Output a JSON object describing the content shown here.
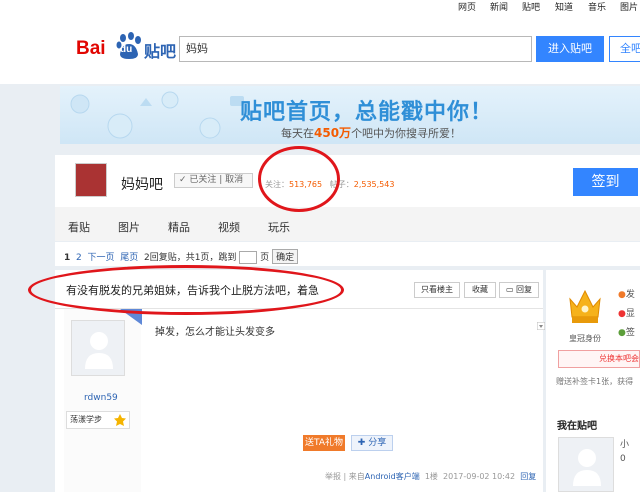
{
  "top_nav": [
    "网页",
    "新闻",
    "贴吧",
    "知道",
    "音乐",
    "图片"
  ],
  "search": {
    "value": "妈妈",
    "enter_label": "进入贴吧",
    "search_all_label": "全吧"
  },
  "logo": {
    "bai": "Bai",
    "du": "du",
    "tieba": "贴吧"
  },
  "banner": {
    "title": "贴吧首页，总能戳中你！",
    "sub_prefix": "每天在",
    "sub_highlight": "450万",
    "sub_suffix": "个吧中为你搜寻所爱！"
  },
  "forum": {
    "name": "妈妈吧",
    "follow_status": "✓ 已关注 | 取消",
    "followers_label": "关注：",
    "followers": "513,765",
    "posts_label": "帖子：",
    "posts": "2,535,543",
    "signin_label": "签到"
  },
  "tabs": [
    "看贴",
    "图片",
    "精品",
    "视频",
    "玩乐"
  ],
  "pager": {
    "current": "1",
    "page2": "2",
    "next": "下一页",
    "last": "尾页",
    "reply_count": "2回复贴，共1页，跳到",
    "page_suffix": "页",
    "confirm": "确定"
  },
  "thread": {
    "title": "有没有脱发的兄弟姐妹，告诉我个止脱方法吧，着急",
    "only_owner": "只看楼主",
    "favorite": "收藏",
    "reply": "回复"
  },
  "post": {
    "author": "rdwn59",
    "level": "荡漾学步",
    "text": "掉发，怎么才能让头发变多",
    "tail_btn": "送TA礼物",
    "share_btn": "分享",
    "meta_report": "举报",
    "meta_from": "| 来自",
    "meta_client": "Android客户端",
    "meta_floor": "1楼",
    "meta_time": "2017-09-02 10:42",
    "meta_reply": "回复"
  },
  "sidebar": {
    "crown_label": "皇冠身份",
    "side_items": [
      "发",
      "显",
      "签"
    ],
    "exchange": "兑换本吧会",
    "gift_note": "赠送补签卡1张，获得",
    "my_tieba": "我在贴吧",
    "my_side": [
      "小",
      "0"
    ]
  },
  "colors": {
    "accent": "#3385ff",
    "highlight": "#f45b00",
    "annotation": "#e0161b"
  }
}
